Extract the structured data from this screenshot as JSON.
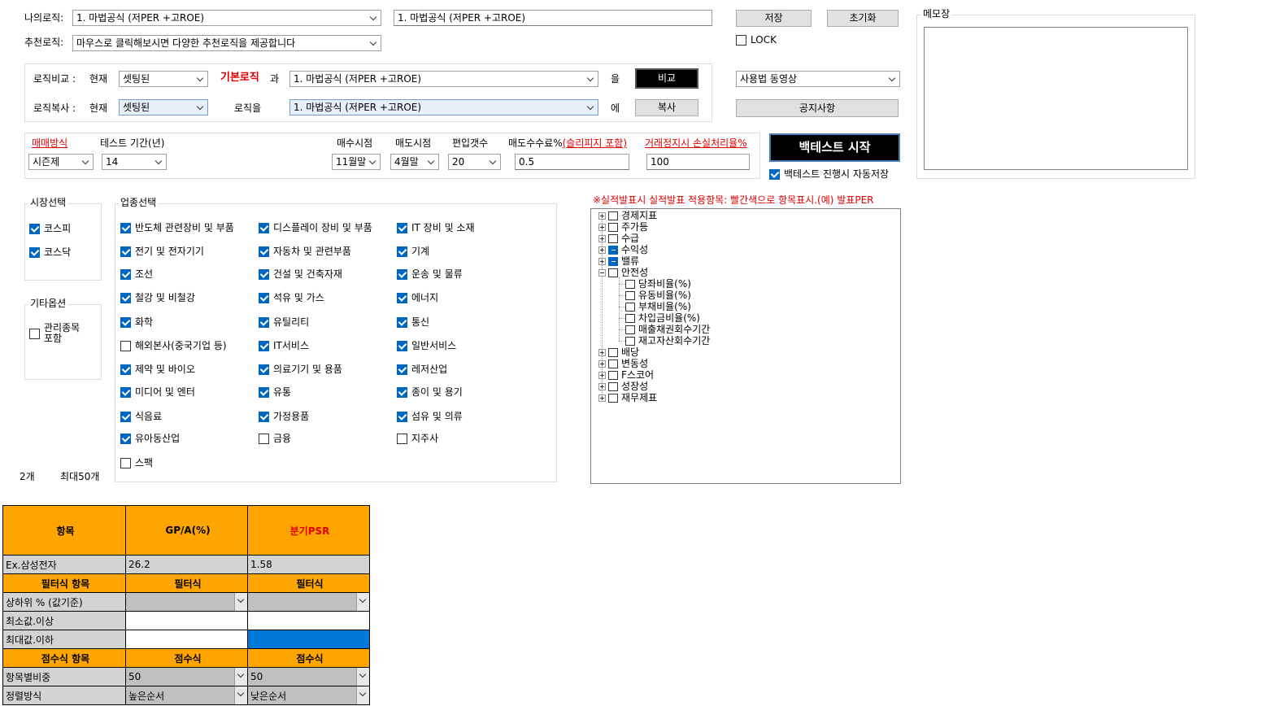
{
  "top": {
    "my_logic_label": "나의로직:",
    "my_logic_value": "1. 마법공식 (저PER +고ROE)",
    "my_logic_text": "1. 마법공식 (저PER +고ROE)",
    "recommend_label": "추천로직:",
    "recommend_value": "마우스로 클릭해보시면 다양한 추천로직을 제공합니다",
    "save_label": "저장",
    "reset_label": "초기화",
    "lock_label": "LOCK",
    "memo_label": "메모장"
  },
  "compare": {
    "row1_label": "로직비교 :",
    "current_label": "현재",
    "current_value": "셋팅된",
    "basic_logic": "기본로직",
    "and_label": "과",
    "target_value": "1. 마법공식 (저PER +고ROE)",
    "eul_label": "을",
    "compare_button": "비교",
    "row2_label": "로직복사 :",
    "current2_value": "셋팅된",
    "logic_eul": "로직을",
    "copy_target": "1. 마법공식 (저PER +고ROE)",
    "e_label": "에",
    "copy_button": "복사",
    "video_select": "사용법 동영상",
    "notice_button": "공지사항"
  },
  "params": {
    "trade_method_label": "매매방식",
    "trade_method_value": "시즌제",
    "test_period_label": "테스트 기간(년)",
    "test_period_value": "14",
    "buy_point_label": "매수시점",
    "buy_point_value": "11월말",
    "sell_point_label": "매도시점",
    "sell_point_value": "4월말",
    "count_label": "편입갯수",
    "count_value": "20",
    "fee_label": "매도수수료%",
    "fee_link": "(슬리피지 포함)",
    "fee_value": "0.5",
    "halt_label": "거래정지시 손실처리율%",
    "halt_value": "100",
    "start_button": "백테스트 시작",
    "autosave_label": "백테스트 진행시 자동저장"
  },
  "market": {
    "title": "시장선택",
    "items": [
      {
        "label": "코스피",
        "checked": true
      },
      {
        "label": "코스닥",
        "checked": true
      }
    ]
  },
  "other": {
    "title": "기타옵션",
    "manage_label": "관리종목 포함"
  },
  "count_text": "2개",
  "max_text": "최대50개",
  "industry": {
    "title": "업종선택",
    "items": [
      {
        "label": "반도체 관련장비 및 부품",
        "checked": true
      },
      {
        "label": "디스플레이 장비 및 부품",
        "checked": true
      },
      {
        "label": "IT 장비 및 소재",
        "checked": true
      },
      {
        "label": "전기 및 전자기기",
        "checked": true
      },
      {
        "label": "자동차 및 관련부품",
        "checked": true
      },
      {
        "label": "기계",
        "checked": true
      },
      {
        "label": "조선",
        "checked": true
      },
      {
        "label": "건설 및 건축자재",
        "checked": true
      },
      {
        "label": "운송 및 물류",
        "checked": true
      },
      {
        "label": "철강 및 비철강",
        "checked": true
      },
      {
        "label": "석유 및 가스",
        "checked": true
      },
      {
        "label": "에너지",
        "checked": true
      },
      {
        "label": "화학",
        "checked": true
      },
      {
        "label": "유틸리티",
        "checked": true
      },
      {
        "label": "통신",
        "checked": true
      },
      {
        "label": "해외본사(중국기업 등)",
        "checked": false
      },
      {
        "label": "IT서비스",
        "checked": true
      },
      {
        "label": "일반서비스",
        "checked": true
      },
      {
        "label": "제약 및 바이오",
        "checked": true
      },
      {
        "label": "의료기기 및 용품",
        "checked": true
      },
      {
        "label": "레저산업",
        "checked": true
      },
      {
        "label": "미디어 및 엔터",
        "checked": true
      },
      {
        "label": "유통",
        "checked": true
      },
      {
        "label": "종이 및 용기",
        "checked": true
      },
      {
        "label": "식음료",
        "checked": true
      },
      {
        "label": "가정용품",
        "checked": true
      },
      {
        "label": "섬유 및 의류",
        "checked": true
      },
      {
        "label": "유아동산업",
        "checked": true
      },
      {
        "label": "금융",
        "checked": false
      },
      {
        "label": "지주사",
        "checked": false
      },
      {
        "label": "스팩",
        "checked": false
      }
    ]
  },
  "tree": {
    "note": "※실적발표시 실적발표 적용항목: 빨간색으로 항목표시.(예) 발표PER",
    "nodes": [
      {
        "label": "경제지표",
        "level": 0,
        "expander": "plus",
        "checked": false
      },
      {
        "label": "주가등",
        "level": 0,
        "expander": "plus",
        "checked": false
      },
      {
        "label": "수급",
        "level": 0,
        "expander": "plus",
        "checked": false
      },
      {
        "label": "수익성",
        "level": 0,
        "expander": "plus",
        "checked": true
      },
      {
        "label": "밸류",
        "level": 0,
        "expander": "plus",
        "checked": true
      },
      {
        "label": "안전성",
        "level": 0,
        "expander": "minus",
        "checked": false
      },
      {
        "label": "당좌비율(%)",
        "level": 1,
        "expander": "",
        "checked": false
      },
      {
        "label": "유동비율(%)",
        "level": 1,
        "expander": "",
        "checked": false
      },
      {
        "label": "부채비율(%)",
        "level": 1,
        "expander": "",
        "checked": false
      },
      {
        "label": "차입금비율(%)",
        "level": 1,
        "expander": "",
        "checked": false
      },
      {
        "label": "매출채권회수기간",
        "level": 1,
        "expander": "",
        "checked": false
      },
      {
        "label": "재고자산회수기간",
        "level": 1,
        "expander": "",
        "checked": false
      },
      {
        "label": "배당",
        "level": 0,
        "expander": "plus",
        "checked": false
      },
      {
        "label": "변동성",
        "level": 0,
        "expander": "plus",
        "checked": false
      },
      {
        "label": "F스코어",
        "level": 0,
        "expander": "plus",
        "checked": false
      },
      {
        "label": "성장성",
        "level": 0,
        "expander": "plus",
        "checked": false
      },
      {
        "label": "재무제표",
        "level": 0,
        "expander": "plus",
        "checked": false
      }
    ]
  },
  "grid": {
    "h_item": "항목",
    "h_col1": "GP/A(%)",
    "h_col2": "분기PSR",
    "ex_label": "Ex.삼성전자",
    "ex_col1": "26.2",
    "ex_col2": "1.58",
    "filter_item": "필터식 항목",
    "filter_col": "필터식",
    "rank_label": "상하위 % (값기준)",
    "min_label": "최소값.이상",
    "max_label": "최대값.이하",
    "score_item": "점수식 항목",
    "score_col": "점수식",
    "weight_label": "항목별비중",
    "weight_col1": "50",
    "weight_col2": "50",
    "sort_label": "정렬방식",
    "sort_col1": "높은순서",
    "sort_col2": "낮은순서"
  }
}
